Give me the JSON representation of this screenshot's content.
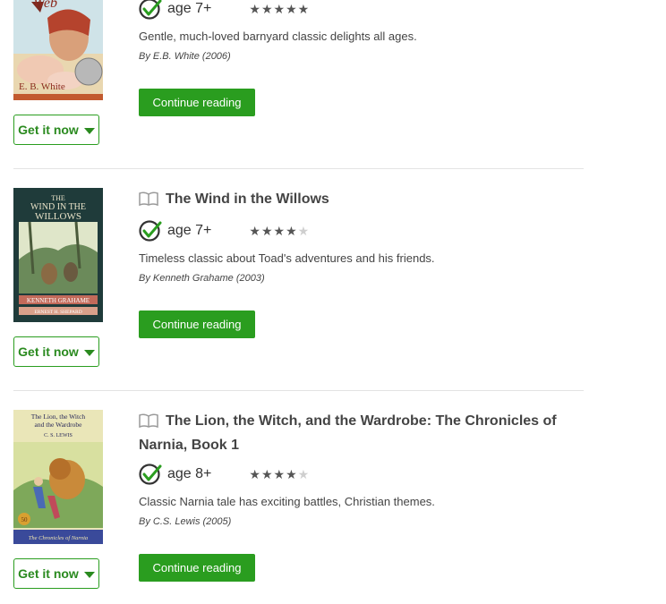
{
  "books": [
    {
      "title": "",
      "age": "age 7+",
      "rating": 5,
      "description": "Gentle, much-loved barnyard classic delights all ages.",
      "byline": "By E.B. White  (2006)",
      "continue_label": "Continue reading",
      "get_label": "Get it now",
      "cover_title": "Web",
      "cover_author": "E. B. White"
    },
    {
      "title": "The Wind in the Willows",
      "age": "age 7+",
      "rating": 4,
      "description": "Timeless classic about Toad's adventures and his friends.",
      "byline": "By Kenneth Grahame  (2003)",
      "continue_label": "Continue reading",
      "get_label": "Get it now",
      "cover_title_1": "THE",
      "cover_title_2": "WIND IN THE",
      "cover_title_3": "WILLOWS",
      "cover_author": "KENNETH GRAHAME",
      "cover_illustrator": "ERNEST H. SHEPARD"
    },
    {
      "title": "The Lion, the Witch, and the Wardrobe: The Chronicles of Narnia, Book 1",
      "age": "age 8+",
      "rating": 4,
      "description": "Classic Narnia tale has exciting battles, Christian themes.",
      "byline": "By C.S. Lewis  (2005)",
      "continue_label": "Continue reading",
      "get_label": "Get it now",
      "cover_title_1": "The Lion, the Witch",
      "cover_title_2": "and the Wardrobe",
      "cover_author": "C. S. LEWIS",
      "cover_series": "The Chronicles of Narnia",
      "cover_badge": "50"
    }
  ],
  "colors": {
    "accent": "#2a9d1f",
    "star_on": "#555555",
    "star_off": "#cfcfcf"
  }
}
